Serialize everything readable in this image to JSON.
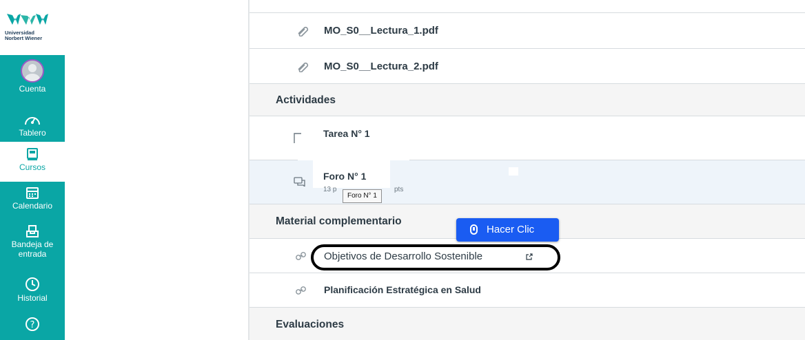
{
  "brand": {
    "line1": "Universidad",
    "line2": "Norbert Wiener"
  },
  "nav": {
    "account": "Cuenta",
    "dashboard": "Tablero",
    "courses": "Cursos",
    "calendar": "Calendario",
    "inbox_line1": "Bandeja de",
    "inbox_line2": "entrada",
    "history": "Historial"
  },
  "modules": {
    "files": [
      "MO_S0__Lectura_1.pdf",
      "MO_S0__Lectura_2.pdf"
    ],
    "activities_header": "Actividades",
    "task": "Tarea N° 1",
    "forum": "Foro N° 1",
    "forum_sub_left": "13 p",
    "forum_sub_right": "pts",
    "tooltip": "Foro N° 1",
    "complementary_header": "Material complementario",
    "links": [
      "Objetivos de Desarrollo Sostenible",
      "Planificación Estratégica en Salud"
    ],
    "evaluations_header": "Evaluaciones"
  },
  "overlay": {
    "click_label": "Hacer Clic"
  },
  "colors": {
    "nav_bg": "#0aa6a5",
    "button": "#1a5cf2",
    "accent_purple": "#9b59c5"
  }
}
